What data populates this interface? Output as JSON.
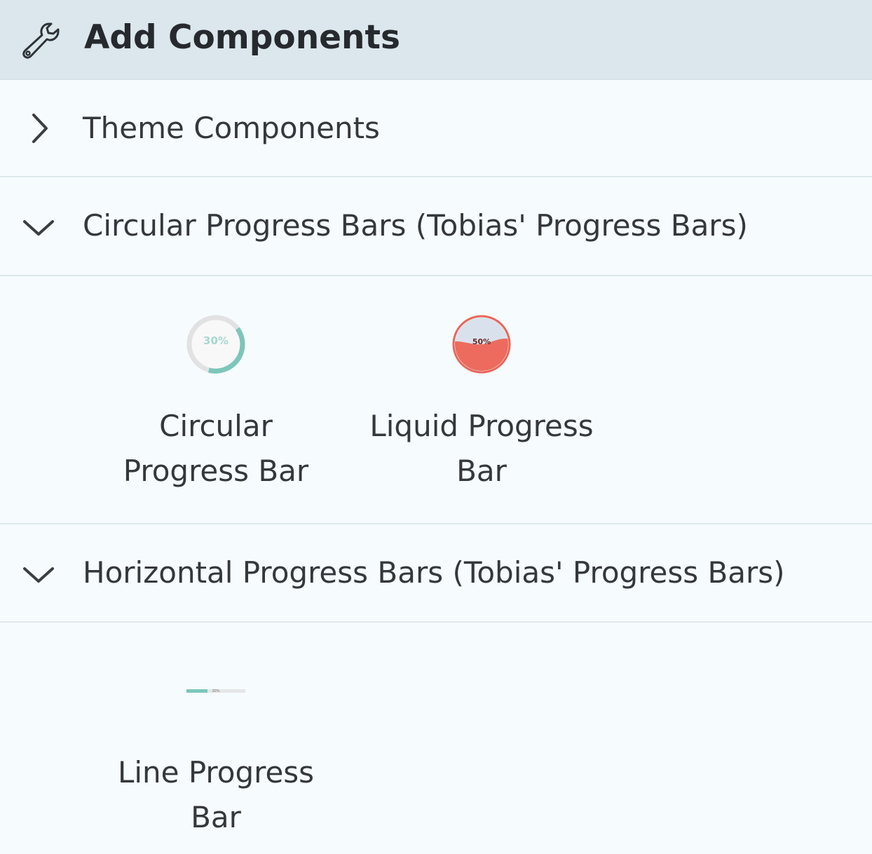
{
  "header": {
    "title": "Add Components",
    "icon": "wrench-icon"
  },
  "sections": [
    {
      "label": "Theme Components",
      "expanded": false,
      "icon": "chevron-right-icon"
    },
    {
      "label": "Circular Progress Bars (Tobias' Progress Bars)",
      "expanded": true,
      "icon": "chevron-down-icon"
    },
    {
      "label": "Horizontal Progress Bars (Tobias' Progress Bars)",
      "expanded": true,
      "icon": "chevron-down-icon"
    }
  ],
  "circular_items": [
    {
      "name": "Circular Progress Bar",
      "thumb_text": "30%",
      "progress": 0.3,
      "accent": "#7cc6bb"
    },
    {
      "name": "Liquid Progress Bar",
      "thumb_text": "50%",
      "progress": 0.5,
      "accent": "#e8685c"
    }
  ],
  "horizontal_items": [
    {
      "name": "Line Progress Bar",
      "thumb_text": "30%",
      "progress": 0.3,
      "accent": "#7cc6bb"
    }
  ],
  "colors": {
    "header_bg": "#dbe7ed",
    "panel_bg": "#f6fbfd",
    "divider": "#dde8ed",
    "text": "#34383c"
  }
}
